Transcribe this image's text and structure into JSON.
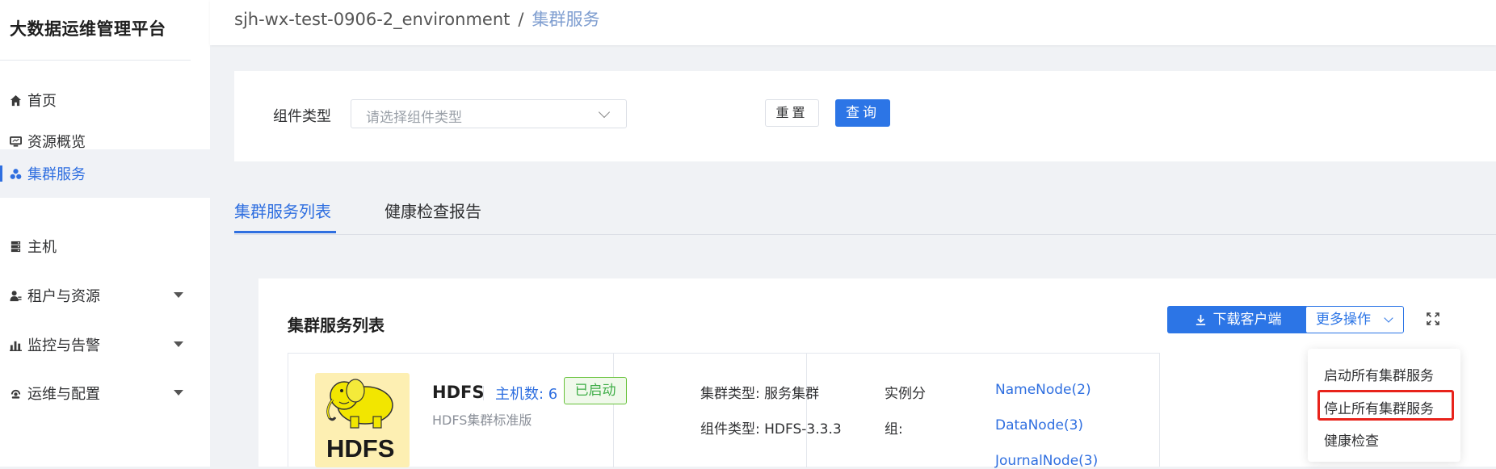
{
  "app": {
    "title": "大数据运维管理平台"
  },
  "sidebar": {
    "items": [
      {
        "label": "首页",
        "icon": "home-icon"
      },
      {
        "label": "资源概览",
        "icon": "monitor-icon"
      },
      {
        "label": "集群服务",
        "icon": "cluster-icon",
        "active": true
      },
      {
        "label": "主机",
        "icon": "server-icon"
      },
      {
        "label": "租户与资源",
        "icon": "user-icon",
        "expandable": true
      },
      {
        "label": "监控与告警",
        "icon": "chart-icon",
        "expandable": true
      },
      {
        "label": "运维与配置",
        "icon": "settings-icon",
        "expandable": true
      }
    ]
  },
  "breadcrumb": {
    "env": "sjh-wx-test-0906-2_environment",
    "separator": "/",
    "current": "集群服务"
  },
  "filter": {
    "component_type_label": "组件类型",
    "component_type_placeholder": "请选择组件类型",
    "reset_label": "重置",
    "query_label": "查询"
  },
  "tabs": [
    {
      "label": "集群服务列表",
      "active": true
    },
    {
      "label": "健康检查报告",
      "active": false
    }
  ],
  "list": {
    "title": "集群服务列表",
    "download_label": "下载客户端",
    "more_label": "更多操作",
    "services": [
      {
        "name": "HDFS",
        "logo_text": "HDFS",
        "hosts_label": "主机数: 6",
        "status": "已启动",
        "subtitle": "HDFS集群标准版",
        "cluster_type": "集群类型: 服务集群",
        "component_type": "组件类型: HDFS-3.3.3",
        "instance_label_1": "实例分",
        "instance_label_2": "组:",
        "instances": [
          "NameNode(2)",
          "DataNode(3)",
          "JournalNode(3)"
        ]
      }
    ]
  },
  "more_menu": {
    "items": [
      "启动所有集群服务",
      "停止所有集群服务",
      "健康检查"
    ],
    "highlighted_index": 1
  },
  "colors": {
    "primary": "#2c75e6",
    "success": "#67c23a",
    "highlight": "#e8231b"
  }
}
